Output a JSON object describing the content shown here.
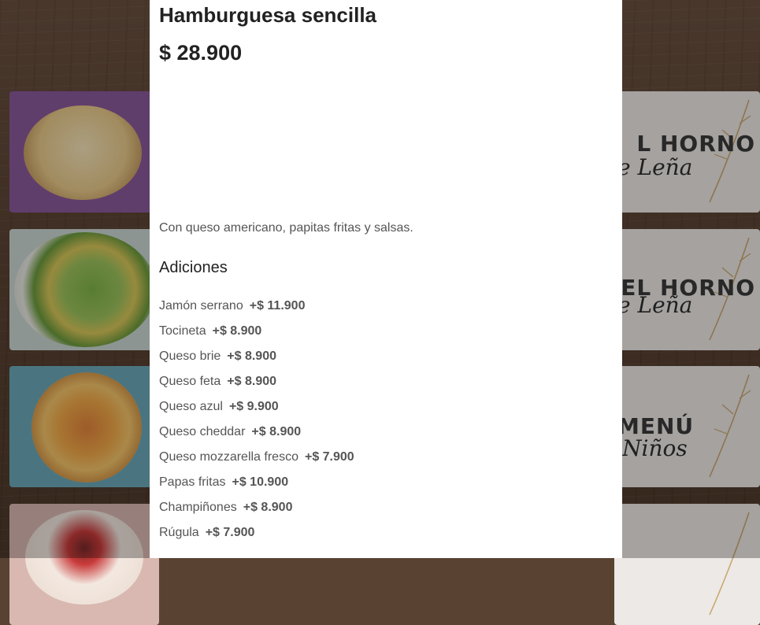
{
  "product": {
    "name": "Hamburguesa sencilla",
    "price": "$ 28.900",
    "description": "Con queso americano, papitas fritas y salsas."
  },
  "addons": {
    "heading": "Adiciones",
    "items": [
      {
        "name": "Jamón serrano",
        "price": "+$ 11.900"
      },
      {
        "name": "Tocineta",
        "price": "+$ 8.900"
      },
      {
        "name": "Queso brie",
        "price": "+$ 8.900"
      },
      {
        "name": "Queso feta",
        "price": "+$ 8.900"
      },
      {
        "name": "Queso azul",
        "price": "+$ 9.900"
      },
      {
        "name": "Queso cheddar",
        "price": "+$ 8.900"
      },
      {
        "name": "Queso mozzarella fresco",
        "price": "+$ 7.900"
      },
      {
        "name": "Papas fritas",
        "price": "+$ 10.900"
      },
      {
        "name": "Champiñones",
        "price": "+$ 8.900"
      },
      {
        "name": "Rúgula",
        "price": "+$ 7.900"
      }
    ]
  },
  "background_tiles": {
    "promo": [
      {
        "line1": "L HORNO",
        "line2": "e Leña"
      },
      {
        "line1": "DEL HORNO",
        "line2": "e Leña"
      },
      {
        "line1": "MENÚ",
        "line2": "Niños"
      }
    ]
  },
  "colors": {
    "modal_bg": "#ffffff",
    "text_dark": "#222222",
    "text_muted": "#555555",
    "backdrop": "#5a4232"
  }
}
